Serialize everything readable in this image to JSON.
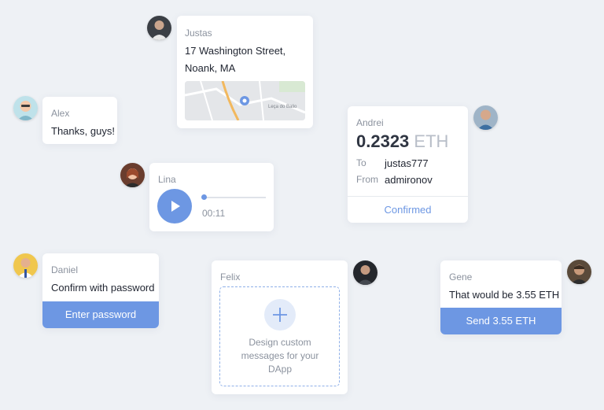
{
  "justas": {
    "name": "Justas",
    "address_line1": "17 Washington Street,",
    "address_line2": "Noank, MA",
    "map_label": "Leça do Balio"
  },
  "alex": {
    "name": "Alex",
    "message": "Thanks, guys!"
  },
  "andrei": {
    "name": "Andrei",
    "amount": "0.2323",
    "currency": "ETH",
    "to_label": "To",
    "to_value": "justas777",
    "from_label": "From",
    "from_value": "admironov",
    "status": "Confirmed"
  },
  "lina": {
    "name": "Lina",
    "duration": "00:11",
    "progress": 0.02
  },
  "daniel": {
    "name": "Daniel",
    "message": "Confirm with password",
    "button": "Enter password"
  },
  "felix": {
    "name": "Felix",
    "add_text": "Design custom messages for your DApp"
  },
  "gene": {
    "name": "Gene",
    "message": "That would be 3.55 ETH",
    "button": "Send 3.55 ETH"
  },
  "colors": {
    "accent": "#6d97e3",
    "background": "#eef1f5",
    "muted": "#8b929e",
    "eth_muted": "#b8bec8"
  }
}
